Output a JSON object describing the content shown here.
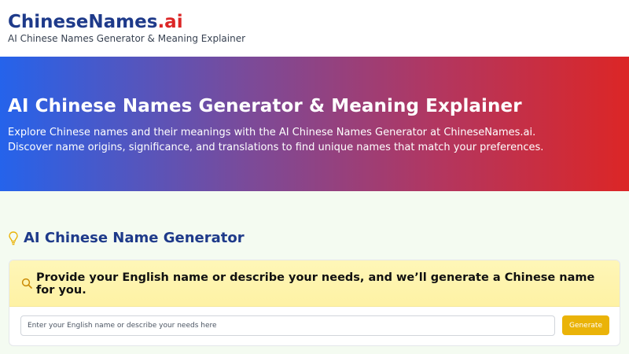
{
  "header": {
    "logo_brand": "ChineseNames",
    "logo_tld": ".ai",
    "tagline": "AI Chinese Names Generator & Meaning Explainer"
  },
  "hero": {
    "title": "AI Chinese Names Generator & Meaning Explainer",
    "description_line1": "Explore Chinese names and their meanings with the AI Chinese Names Generator at ChineseNames.ai.",
    "description_line2": "Discover name origins, significance, and translations to find unique names that match your preferences."
  },
  "generator": {
    "section_title": "AI Chinese Name Generator",
    "section_icon": "lightbulb-icon",
    "prompt_icon": "search-icon",
    "prompt": "Provide your English name or describe your needs, and we’ll generate a Chinese name for you.",
    "input_value": "",
    "input_placeholder": "Enter your English name or describe your needs here",
    "button_label": "Generate"
  },
  "colors": {
    "brand_blue": "#1e3a8a",
    "brand_red": "#dc2626",
    "accent_yellow": "#eab308",
    "hero_gradient_start": "#2563eb",
    "hero_gradient_end": "#dc2626"
  }
}
